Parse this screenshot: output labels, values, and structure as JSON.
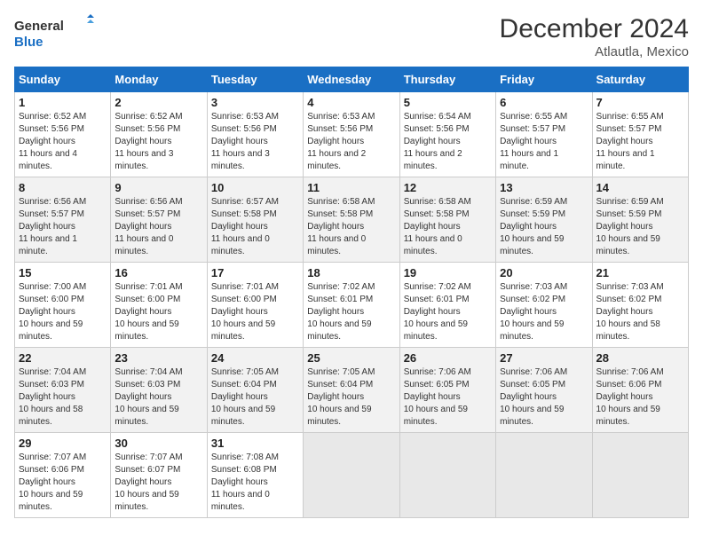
{
  "header": {
    "logo_general": "General",
    "logo_blue": "Blue",
    "month_title": "December 2024",
    "location": "Atlautla, Mexico"
  },
  "days_of_week": [
    "Sunday",
    "Monday",
    "Tuesday",
    "Wednesday",
    "Thursday",
    "Friday",
    "Saturday"
  ],
  "weeks": [
    [
      {
        "day": "1",
        "sunrise": "6:52 AM",
        "sunset": "5:56 PM",
        "daylight": "11 hours and 4 minutes."
      },
      {
        "day": "2",
        "sunrise": "6:52 AM",
        "sunset": "5:56 PM",
        "daylight": "11 hours and 3 minutes."
      },
      {
        "day": "3",
        "sunrise": "6:53 AM",
        "sunset": "5:56 PM",
        "daylight": "11 hours and 3 minutes."
      },
      {
        "day": "4",
        "sunrise": "6:53 AM",
        "sunset": "5:56 PM",
        "daylight": "11 hours and 2 minutes."
      },
      {
        "day": "5",
        "sunrise": "6:54 AM",
        "sunset": "5:56 PM",
        "daylight": "11 hours and 2 minutes."
      },
      {
        "day": "6",
        "sunrise": "6:55 AM",
        "sunset": "5:57 PM",
        "daylight": "11 hours and 1 minute."
      },
      {
        "day": "7",
        "sunrise": "6:55 AM",
        "sunset": "5:57 PM",
        "daylight": "11 hours and 1 minute."
      }
    ],
    [
      {
        "day": "8",
        "sunrise": "6:56 AM",
        "sunset": "5:57 PM",
        "daylight": "11 hours and 1 minute."
      },
      {
        "day": "9",
        "sunrise": "6:56 AM",
        "sunset": "5:57 PM",
        "daylight": "11 hours and 0 minutes."
      },
      {
        "day": "10",
        "sunrise": "6:57 AM",
        "sunset": "5:58 PM",
        "daylight": "11 hours and 0 minutes."
      },
      {
        "day": "11",
        "sunrise": "6:58 AM",
        "sunset": "5:58 PM",
        "daylight": "11 hours and 0 minutes."
      },
      {
        "day": "12",
        "sunrise": "6:58 AM",
        "sunset": "5:58 PM",
        "daylight": "11 hours and 0 minutes."
      },
      {
        "day": "13",
        "sunrise": "6:59 AM",
        "sunset": "5:59 PM",
        "daylight": "10 hours and 59 minutes."
      },
      {
        "day": "14",
        "sunrise": "6:59 AM",
        "sunset": "5:59 PM",
        "daylight": "10 hours and 59 minutes."
      }
    ],
    [
      {
        "day": "15",
        "sunrise": "7:00 AM",
        "sunset": "6:00 PM",
        "daylight": "10 hours and 59 minutes."
      },
      {
        "day": "16",
        "sunrise": "7:01 AM",
        "sunset": "6:00 PM",
        "daylight": "10 hours and 59 minutes."
      },
      {
        "day": "17",
        "sunrise": "7:01 AM",
        "sunset": "6:00 PM",
        "daylight": "10 hours and 59 minutes."
      },
      {
        "day": "18",
        "sunrise": "7:02 AM",
        "sunset": "6:01 PM",
        "daylight": "10 hours and 59 minutes."
      },
      {
        "day": "19",
        "sunrise": "7:02 AM",
        "sunset": "6:01 PM",
        "daylight": "10 hours and 59 minutes."
      },
      {
        "day": "20",
        "sunrise": "7:03 AM",
        "sunset": "6:02 PM",
        "daylight": "10 hours and 59 minutes."
      },
      {
        "day": "21",
        "sunrise": "7:03 AM",
        "sunset": "6:02 PM",
        "daylight": "10 hours and 58 minutes."
      }
    ],
    [
      {
        "day": "22",
        "sunrise": "7:04 AM",
        "sunset": "6:03 PM",
        "daylight": "10 hours and 58 minutes."
      },
      {
        "day": "23",
        "sunrise": "7:04 AM",
        "sunset": "6:03 PM",
        "daylight": "10 hours and 59 minutes."
      },
      {
        "day": "24",
        "sunrise": "7:05 AM",
        "sunset": "6:04 PM",
        "daylight": "10 hours and 59 minutes."
      },
      {
        "day": "25",
        "sunrise": "7:05 AM",
        "sunset": "6:04 PM",
        "daylight": "10 hours and 59 minutes."
      },
      {
        "day": "26",
        "sunrise": "7:06 AM",
        "sunset": "6:05 PM",
        "daylight": "10 hours and 59 minutes."
      },
      {
        "day": "27",
        "sunrise": "7:06 AM",
        "sunset": "6:05 PM",
        "daylight": "10 hours and 59 minutes."
      },
      {
        "day": "28",
        "sunrise": "7:06 AM",
        "sunset": "6:06 PM",
        "daylight": "10 hours and 59 minutes."
      }
    ],
    [
      {
        "day": "29",
        "sunrise": "7:07 AM",
        "sunset": "6:06 PM",
        "daylight": "10 hours and 59 minutes."
      },
      {
        "day": "30",
        "sunrise": "7:07 AM",
        "sunset": "6:07 PM",
        "daylight": "10 hours and 59 minutes."
      },
      {
        "day": "31",
        "sunrise": "7:08 AM",
        "sunset": "6:08 PM",
        "daylight": "11 hours and 0 minutes."
      },
      null,
      null,
      null,
      null
    ]
  ]
}
